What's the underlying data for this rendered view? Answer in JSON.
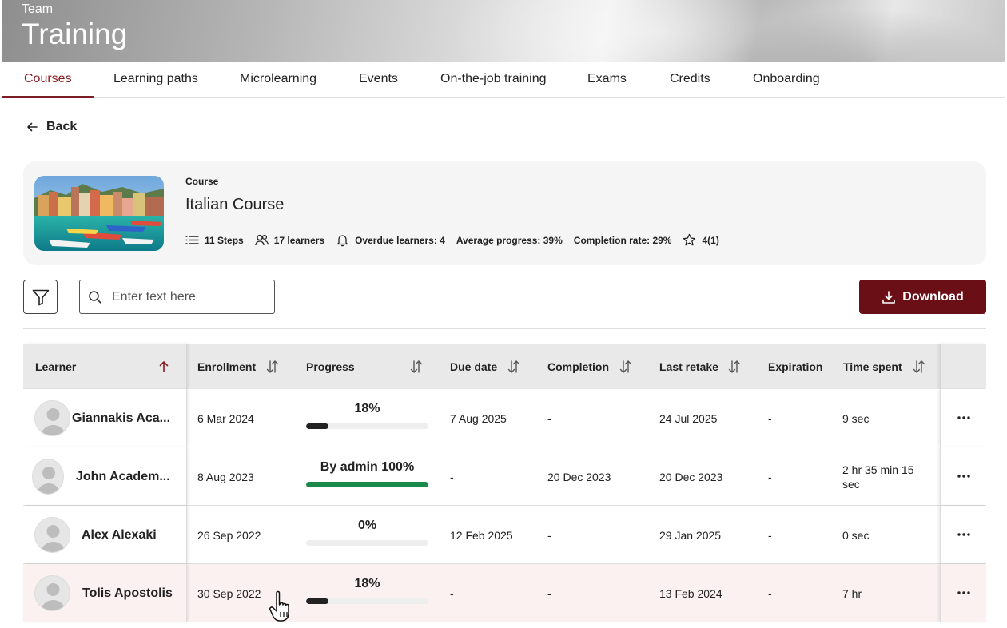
{
  "header": {
    "subtitle": "Team",
    "title": "Training"
  },
  "tabs": [
    {
      "label": "Courses",
      "active": true
    },
    {
      "label": "Learning paths"
    },
    {
      "label": "Microlearning"
    },
    {
      "label": "Events"
    },
    {
      "label": "On-the-job training"
    },
    {
      "label": "Exams"
    },
    {
      "label": "Credits"
    },
    {
      "label": "Onboarding"
    }
  ],
  "back": {
    "label": "Back"
  },
  "course": {
    "label": "Course",
    "title": "Italian Course",
    "steps": "11 Steps",
    "learners": "17 learners",
    "overdue": "Overdue learners: 4",
    "avg_progress": "Average progress: 39%",
    "completion_rate": "Completion rate: 29%",
    "rating": "4(1)"
  },
  "toolbar": {
    "search_placeholder": "Enter text here",
    "download_label": "Download"
  },
  "table": {
    "columns": [
      "Learner",
      "Enrollment",
      "Progress",
      "Due date",
      "Completion",
      "Last retake",
      "Expiration",
      "Time spent"
    ],
    "rows": [
      {
        "learner": "Giannakis Aca...",
        "enrollment": "6 Mar 2024",
        "progress_label": "18%",
        "progress": 0.18,
        "due": "7 Aug 2025",
        "completion": "-",
        "last_retake": "24 Jul 2025",
        "expiration": "-",
        "time_spent": "9 sec"
      },
      {
        "learner": "John Academ...",
        "enrollment": "8 Aug 2023",
        "progress_label": "By admin 100%",
        "progress": 1.0,
        "due": "-",
        "completion": "20 Dec 2023",
        "last_retake": "20 Dec 2023",
        "expiration": "-",
        "time_spent": "2 hr 35 min 15 sec"
      },
      {
        "learner": "Alex Alexaki",
        "enrollment": "26 Sep 2022",
        "progress_label": "0%",
        "progress": 0.0,
        "due": "12 Feb 2025",
        "completion": "-",
        "last_retake": "29 Jan 2025",
        "expiration": "-",
        "time_spent": "0 sec"
      },
      {
        "learner": "Tolis Apostolis",
        "enrollment": "30 Sep 2022",
        "progress_label": "18%",
        "progress": 0.18,
        "due": "-",
        "completion": "-",
        "last_retake": "13 Feb 2024",
        "expiration": "-",
        "time_spent": "7 hr"
      }
    ]
  },
  "colors": {
    "accent": "#7b1e23",
    "download_bg": "#6b0f17",
    "progress_complete": "#1a8a4a",
    "progress_partial": "#222222",
    "hover_row": "#fcf1f1"
  }
}
